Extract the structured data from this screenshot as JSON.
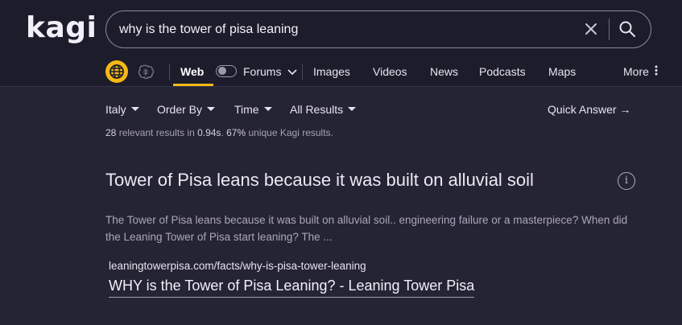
{
  "brand": {
    "logo_text": "kagi"
  },
  "search": {
    "query": "why is the tower of pisa leaning"
  },
  "tabs": {
    "web": "Web",
    "forums": "Forums",
    "images": "Images",
    "videos": "Videos",
    "news": "News",
    "podcasts": "Podcasts",
    "maps": "Maps",
    "more": "More"
  },
  "filters": {
    "region": "Italy",
    "order": "Order By",
    "time": "Time",
    "results": "All Results",
    "quick_answer": "Quick Answer →"
  },
  "stats": {
    "count": "28",
    "count_suffix": " relevant results in ",
    "time": "0.94s",
    "separator": ". ",
    "unique": "67%",
    "unique_suffix": " unique Kagi results."
  },
  "quick_answer": {
    "title": "Tower of Pisa leans because it was built on alluvial soil",
    "info_glyph": "i",
    "snippet": "The Tower of Pisa leans because it was built on alluvial soil.. engineering failure or a masterpiece? When did the Leaning Tower of Pisa start leaning? The ..."
  },
  "result": {
    "url": "leaningtowerpisa.com/facts/why-is-pisa-tower-leaning",
    "title": "WHY is the Tower of Pisa Leaning? - Leaning Tower Pisa"
  },
  "colors": {
    "accent": "#f5b815",
    "background": "#252434",
    "header_background": "#1d1c2b"
  },
  "icons": [
    "close-icon",
    "search-icon",
    "globe-icon",
    "assistant-icon",
    "chevron-down-icon",
    "more-dots-icon",
    "info-icon"
  ]
}
